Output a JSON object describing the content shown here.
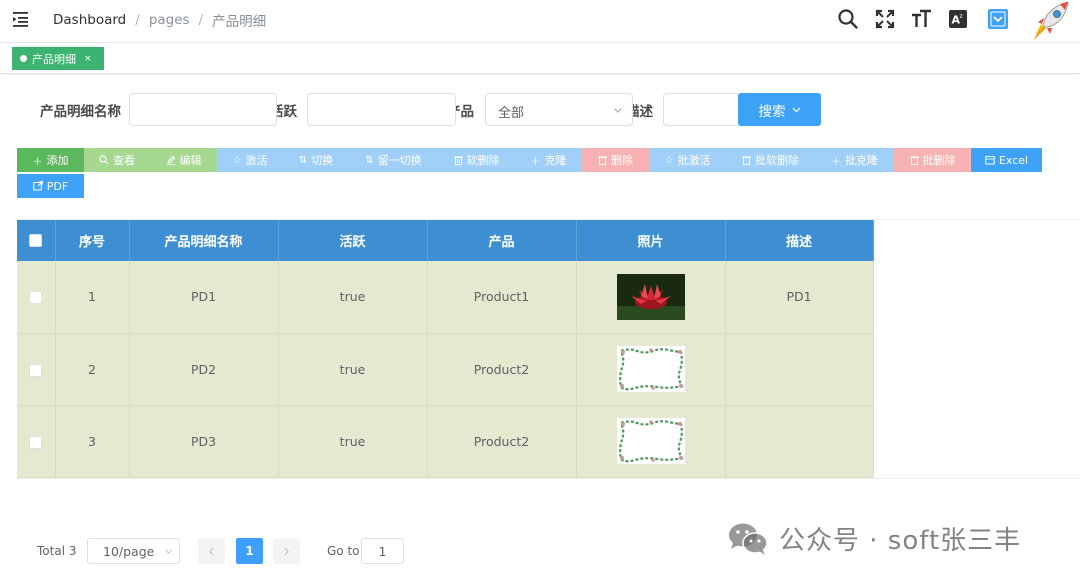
{
  "header": {
    "breadcrumb": [
      "Dashboard",
      "pages",
      "产品明细"
    ],
    "separator": "/",
    "icons": [
      "search-icon",
      "fullscreen-icon",
      "font-size-icon",
      "language-icon",
      "dropdown-icon",
      "rocket-icon"
    ]
  },
  "tags": [
    {
      "label": "产品明细",
      "active": true,
      "close": "×"
    }
  ],
  "search": {
    "fields": [
      {
        "label": "产品明细名称",
        "value": ""
      },
      {
        "label": "活跃",
        "value": ""
      },
      {
        "label": "产品",
        "value": "全部"
      },
      {
        "label": "描述",
        "value": ""
      }
    ],
    "button_label": "搜索"
  },
  "toolbar": {
    "buttons": [
      {
        "label": "添加",
        "icon": "plus-icon",
        "color": "#5cb85c"
      },
      {
        "label": "查看",
        "icon": "search-icon",
        "color": "#a6d892"
      },
      {
        "label": "编辑",
        "icon": "edit-icon",
        "color": "#a6d892"
      },
      {
        "label": "激活",
        "icon": "star-icon",
        "color": "#a0cff7"
      },
      {
        "label": "切换",
        "icon": "sort-icon",
        "color": "#a0cff7"
      },
      {
        "label": "留一切换",
        "icon": "sort-icon",
        "color": "#a0cff7"
      },
      {
        "label": "软删除",
        "icon": "trash-icon",
        "color": "#a0cff7"
      },
      {
        "label": "克隆",
        "icon": "plus-icon",
        "color": "#a0cff7"
      },
      {
        "label": "删除",
        "icon": "trash-icon",
        "color": "#f7b3b3"
      },
      {
        "label": "批激活",
        "icon": "star-icon",
        "color": "#a0cff7"
      },
      {
        "label": "批软删除",
        "icon": "trash-icon",
        "color": "#a0cff7"
      },
      {
        "label": "批克隆",
        "icon": "plus-icon",
        "color": "#a0cff7"
      },
      {
        "label": "批删除",
        "icon": "trash-icon",
        "color": "#f7b3b3"
      },
      {
        "label": "Excel",
        "icon": "calendar-icon",
        "color": "#3ea3f7"
      },
      {
        "label": "PDF",
        "icon": "export-icon",
        "color": "#3ea3f7"
      }
    ]
  },
  "table": {
    "columns": [
      "序号",
      "产品明细名称",
      "活跃",
      "产品",
      "照片",
      "描述"
    ],
    "rows": [
      {
        "index": "1",
        "name": "PD1",
        "active": "true",
        "product": "Product1",
        "photo": "red-lotus",
        "desc": "PD1"
      },
      {
        "index": "2",
        "name": "PD2",
        "active": "true",
        "product": "Product2",
        "photo": "leaf-frame",
        "desc": ""
      },
      {
        "index": "3",
        "name": "PD3",
        "active": "true",
        "product": "Product2",
        "photo": "leaf-frame",
        "desc": ""
      }
    ]
  },
  "pagination": {
    "total_label": "Total 3",
    "page_size": "10/page",
    "current_page": "1",
    "goto_label": "Go to",
    "goto_value": "1"
  },
  "watermark": "公众号 · soft张三丰",
  "colors": {
    "header_blue": "#3d8fd1",
    "row_bg": "#e5e9d0",
    "primary": "#409eff",
    "tag_green": "#3cb371"
  }
}
